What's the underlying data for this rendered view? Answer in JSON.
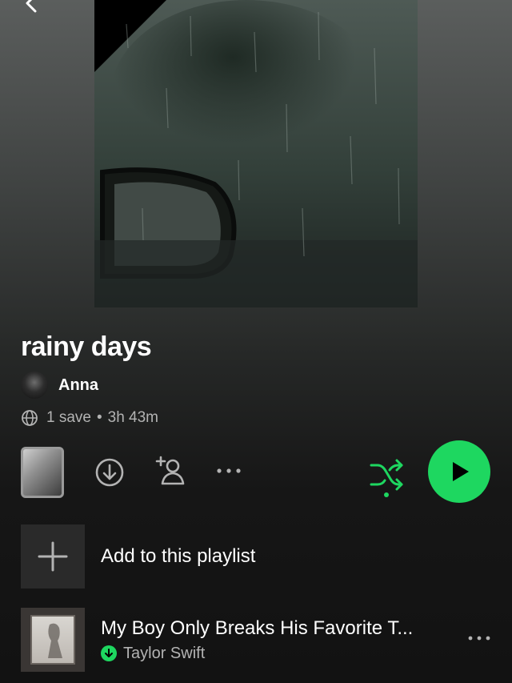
{
  "header": {
    "back_icon": "chevron-left-icon"
  },
  "playlist": {
    "title": "rainy days",
    "owner": "Anna",
    "saves": "1 save",
    "separator": "•",
    "duration": "3h 43m"
  },
  "controls": {
    "download_icon": "download-icon",
    "add_user_icon": "add-user-icon",
    "more_icon": "more-icon",
    "shuffle_icon": "shuffle-icon",
    "play_icon": "play-icon"
  },
  "add_to_playlist": {
    "label": "Add to this playlist"
  },
  "tracks": [
    {
      "title": "My Boy Only Breaks His Favorite T...",
      "artist": "Taylor Swift",
      "downloaded": true
    }
  ],
  "colors": {
    "accent": "#1ed760",
    "background": "#121212",
    "secondary_text": "#b3b3b3"
  }
}
